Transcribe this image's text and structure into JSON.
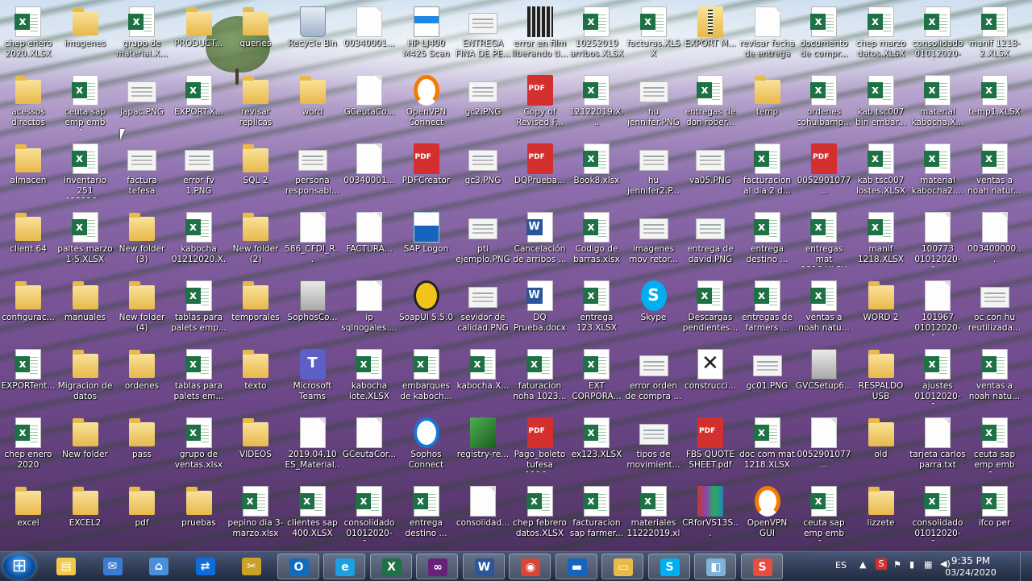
{
  "desktop": {
    "icons": [
      {
        "label": "chep enero 2020.XLSX",
        "type": "xl"
      },
      {
        "label": "imagenes",
        "type": "folder"
      },
      {
        "label": "grupo de material.X...",
        "type": "xl"
      },
      {
        "label": "PRODUCT...",
        "type": "folder"
      },
      {
        "label": "queries",
        "type": "folder"
      },
      {
        "label": "Recycle Bin",
        "type": "bin"
      },
      {
        "label": "00340001...",
        "type": "file"
      },
      {
        "label": "HP LJ400 M425 Scan",
        "type": "scan"
      },
      {
        "label": "ENTREGA FINA DE PE...",
        "type": "img"
      },
      {
        "label": "error en film liberando ti...",
        "type": "film"
      },
      {
        "label": "10252019 arribos.XLSX",
        "type": "xl"
      },
      {
        "label": "facturas.XLSX",
        "type": "xl"
      },
      {
        "label": "EXPORT M...",
        "type": "zip"
      },
      {
        "label": "revisar fecha de entrega ...",
        "type": "file"
      },
      {
        "label": "documento de compr...",
        "type": "xl"
      },
      {
        "label": "chep marzo datos.XLSX",
        "type": "xl"
      },
      {
        "label": "consolidado 01012020-1...",
        "type": "xl"
      },
      {
        "label": "manif 1218-2.XLSX",
        "type": "xl"
      },
      {
        "label": "acessos directos",
        "type": "folder"
      },
      {
        "label": "ceuta sap emp emb 0...",
        "type": "xl"
      },
      {
        "label": "japac.PNG",
        "type": "img"
      },
      {
        "label": "EXPORT.X...",
        "type": "xl"
      },
      {
        "label": "revisar replicas",
        "type": "folder"
      },
      {
        "label": "word",
        "type": "folder"
      },
      {
        "label": "GCeutaCo...",
        "type": "file"
      },
      {
        "label": "OpenVPN Connect",
        "type": "vpn"
      },
      {
        "label": "gc2.PNG",
        "type": "img"
      },
      {
        "label": "Copy of Revised F...",
        "type": "pdf"
      },
      {
        "label": "12122019.X...",
        "type": "xl"
      },
      {
        "label": "hu jennifer.PNG",
        "type": "img"
      },
      {
        "label": "entregas de don rober...",
        "type": "xl"
      },
      {
        "label": "temp",
        "type": "folder"
      },
      {
        "label": "ordenes cohuibamp...",
        "type": "xl"
      },
      {
        "label": "kab tsc007 bin embar...",
        "type": "xl"
      },
      {
        "label": "material kabocha.X...",
        "type": "xl"
      },
      {
        "label": "temp1.XLSX",
        "type": "xl"
      },
      {
        "label": "almacen",
        "type": "folder"
      },
      {
        "label": "inventario 251 022220...",
        "type": "xl"
      },
      {
        "label": "factura tefesa regreso ma...",
        "type": "img"
      },
      {
        "label": "error fv 1.PNG",
        "type": "img"
      },
      {
        "label": "SQL 2",
        "type": "folder"
      },
      {
        "label": "persona responsabl...",
        "type": "img"
      },
      {
        "label": "00340001...",
        "type": "file"
      },
      {
        "label": "PDFCreator",
        "type": "pdf"
      },
      {
        "label": "gc3.PNG",
        "type": "img"
      },
      {
        "label": "DQPrueba...",
        "type": "pdf"
      },
      {
        "label": "Book8.xlsx",
        "type": "xl"
      },
      {
        "label": "hu jennifer2.P...",
        "type": "img"
      },
      {
        "label": "va05.PNG",
        "type": "img"
      },
      {
        "label": "facturacion al dia 2 d...",
        "type": "xl"
      },
      {
        "label": "0052901077...",
        "type": "pdf"
      },
      {
        "label": "kab tsc007 lostes.XLSX",
        "type": "xl"
      },
      {
        "label": "material kabocha2....",
        "type": "xl"
      },
      {
        "label": "ventas a noah natur...",
        "type": "xl"
      },
      {
        "label": "client 64",
        "type": "folder"
      },
      {
        "label": "paltes marzo 1-5.XLSX",
        "type": "xl"
      },
      {
        "label": "New folder (3)",
        "type": "folder"
      },
      {
        "label": "kabocha 01212020.X...",
        "type": "xl"
      },
      {
        "label": "New folder (2)",
        "type": "folder"
      },
      {
        "label": "586_CFDI_R...",
        "type": "file"
      },
      {
        "label": "FACTURA...",
        "type": "file"
      },
      {
        "label": "SAP Logon",
        "type": "sap"
      },
      {
        "label": "pti ejemplo.PNG",
        "type": "img"
      },
      {
        "label": "Cancelación de arribos ...",
        "type": "word"
      },
      {
        "label": "Codigo de barras.xlsx",
        "type": "xl"
      },
      {
        "label": "imagenes mov retor...",
        "type": "img"
      },
      {
        "label": "entrega de david.PNG",
        "type": "img"
      },
      {
        "label": "entrega destino ...",
        "type": "xl"
      },
      {
        "label": "entregas mat 1218.XLSX",
        "type": "xl"
      },
      {
        "label": "manif 1218.XLSX",
        "type": "xl"
      },
      {
        "label": "100773 01012020-1...",
        "type": "file"
      },
      {
        "label": "003400000...",
        "type": "file"
      },
      {
        "label": "configurac...",
        "type": "folder"
      },
      {
        "label": "manuales",
        "type": "folder"
      },
      {
        "label": "New folder (4)",
        "type": "folder"
      },
      {
        "label": "tablas para palets emp...",
        "type": "xl"
      },
      {
        "label": "temporales",
        "type": "folder"
      },
      {
        "label": "SophosCo...",
        "type": "setup"
      },
      {
        "label": "ip sqlnogales....",
        "type": "file"
      },
      {
        "label": "SoapUI 5.5.0",
        "type": "soap"
      },
      {
        "label": "sevidor de calidad.PNG",
        "type": "img"
      },
      {
        "label": "DQ Prueba.docx",
        "type": "word"
      },
      {
        "label": "entrega 123.XLSX",
        "type": "xl"
      },
      {
        "label": "Skype",
        "type": "skype"
      },
      {
        "label": "Descargas pendientes...",
        "type": "xl"
      },
      {
        "label": "entregas de farmers ...",
        "type": "xl"
      },
      {
        "label": "ventas a noah natu...",
        "type": "xl"
      },
      {
        "label": "WORD 2",
        "type": "folder"
      },
      {
        "label": "101967 01012020-1...",
        "type": "file"
      },
      {
        "label": "oc con hu reutilizada...",
        "type": "img"
      },
      {
        "label": "EXPORTent...",
        "type": "xl"
      },
      {
        "label": "Migracion de datos",
        "type": "folder"
      },
      {
        "label": "ordenes",
        "type": "folder"
      },
      {
        "label": "tablas para palets em...",
        "type": "xl"
      },
      {
        "label": "texto",
        "type": "folder"
      },
      {
        "label": "Microsoft Teams",
        "type": "teams"
      },
      {
        "label": "kabocha lote.XLSX",
        "type": "xl"
      },
      {
        "label": "embarques de kaboch...",
        "type": "xl"
      },
      {
        "label": "kabocha.X...",
        "type": "xl"
      },
      {
        "label": "faturacion noha 1023...",
        "type": "xl"
      },
      {
        "label": "EXT CORPORA...",
        "type": "xl"
      },
      {
        "label": "error orden de compra ...",
        "type": "img"
      },
      {
        "label": "construcci...",
        "type": "tools"
      },
      {
        "label": "gc01.PNG",
        "type": "img"
      },
      {
        "label": "GVCSetup6...",
        "type": "setup"
      },
      {
        "label": "RESPALDO USB",
        "type": "folder"
      },
      {
        "label": "ajustes 01012020-1...",
        "type": "xl"
      },
      {
        "label": "ventas a noah natu...",
        "type": "xl"
      },
      {
        "label": "chep enero 2020 cance...",
        "type": "xl"
      },
      {
        "label": "New folder",
        "type": "folder"
      },
      {
        "label": "pass",
        "type": "folder"
      },
      {
        "label": "grupo de ventas.xlsx",
        "type": "xl"
      },
      {
        "label": "VIDEOS",
        "type": "folder"
      },
      {
        "label": "2019.04.10 ES_Material...",
        "type": "file"
      },
      {
        "label": "GCeutaCor...",
        "type": "file"
      },
      {
        "label": "Sophos Connect",
        "type": "sophos"
      },
      {
        "label": "registry-re...",
        "type": "reg"
      },
      {
        "label": "Pago_boleto tufesa 1116...",
        "type": "pdf"
      },
      {
        "label": "ex123.XLSX",
        "type": "xl"
      },
      {
        "label": "tipos de movimient...",
        "type": "img"
      },
      {
        "label": "FBS QUOTE SHEET.pdf",
        "type": "pdf"
      },
      {
        "label": "doc com mat 1218.XLSX",
        "type": "xl"
      },
      {
        "label": "0052901077...",
        "type": "file"
      },
      {
        "label": "old",
        "type": "folder"
      },
      {
        "label": "tarjeta carlos parra.txt",
        "type": "file"
      },
      {
        "label": "ceuta sap emp emb 0...",
        "type": "xl"
      },
      {
        "label": "excel",
        "type": "folder"
      },
      {
        "label": "EXCEL2",
        "type": "folder"
      },
      {
        "label": "pdf",
        "type": "folder"
      },
      {
        "label": "pruebas",
        "type": "folder"
      },
      {
        "label": "pepino dia 3-marzo.xlsx",
        "type": "xl"
      },
      {
        "label": "clientes sap 400.XLSX",
        "type": "xl"
      },
      {
        "label": "consolidado 01012020-1...",
        "type": "xl"
      },
      {
        "label": "entrega destino ...",
        "type": "xl"
      },
      {
        "label": "consolidad...",
        "type": "file"
      },
      {
        "label": "chep febrero datos.XLSX",
        "type": "xl"
      },
      {
        "label": "facturacion sap farmer...",
        "type": "xl"
      },
      {
        "label": "materiales 11222019.xls",
        "type": "xl"
      },
      {
        "label": "CRforVS13S...",
        "type": "arch"
      },
      {
        "label": "OpenVPN GUI",
        "type": "vpn"
      },
      {
        "label": "ceuta sap emp emb 0...",
        "type": "xl"
      },
      {
        "label": "lizzete",
        "type": "folder"
      },
      {
        "label": "consolidado 01012020-1...",
        "type": "xl"
      },
      {
        "label": "ifco per",
        "type": "xl"
      }
    ]
  },
  "taskbar": {
    "items": [
      {
        "name": "file-explorer-icon",
        "glyph": "▤",
        "color": "#f2c94c",
        "active": false
      },
      {
        "name": "mail-icon",
        "glyph": "✉",
        "color": "#3a7bd5",
        "active": false
      },
      {
        "name": "network-icon",
        "glyph": "⌂",
        "color": "#4a90d9",
        "active": false
      },
      {
        "name": "teamviewer-icon",
        "glyph": "⇄",
        "color": "#0e6dd9",
        "active": false
      },
      {
        "name": "tools-icon",
        "glyph": "✂",
        "color": "#c9a227",
        "active": false
      },
      {
        "name": "outlook-icon",
        "glyph": "O",
        "color": "#0f6cbd",
        "active": true
      },
      {
        "name": "internet-explorer-icon",
        "glyph": "e",
        "color": "#1ba1e2",
        "active": true
      },
      {
        "name": "excel-icon",
        "glyph": "X",
        "color": "#1e7145",
        "active": true
      },
      {
        "name": "visual-studio-icon",
        "glyph": "∞",
        "color": "#68217a",
        "active": true
      },
      {
        "name": "word-icon",
        "glyph": "W",
        "color": "#2b579a",
        "active": true
      },
      {
        "name": "chrome-icon",
        "glyph": "◉",
        "color": "#db4437",
        "active": true
      },
      {
        "name": "sap-icon",
        "glyph": "▬",
        "color": "#1565c0",
        "active": true
      },
      {
        "name": "folder-icon",
        "glyph": "▭",
        "color": "#e8b94b",
        "active": true
      },
      {
        "name": "skype-icon",
        "glyph": "S",
        "color": "#00aff0",
        "active": true
      },
      {
        "name": "notes-icon",
        "glyph": "◧",
        "color": "#7fb2d9",
        "active": true
      },
      {
        "name": "snagit-icon",
        "glyph": "S",
        "color": "#e84c3d",
        "active": true
      }
    ],
    "tray": {
      "language": "ES",
      "time": "9:35 PM",
      "date": "03/24/2020"
    }
  }
}
